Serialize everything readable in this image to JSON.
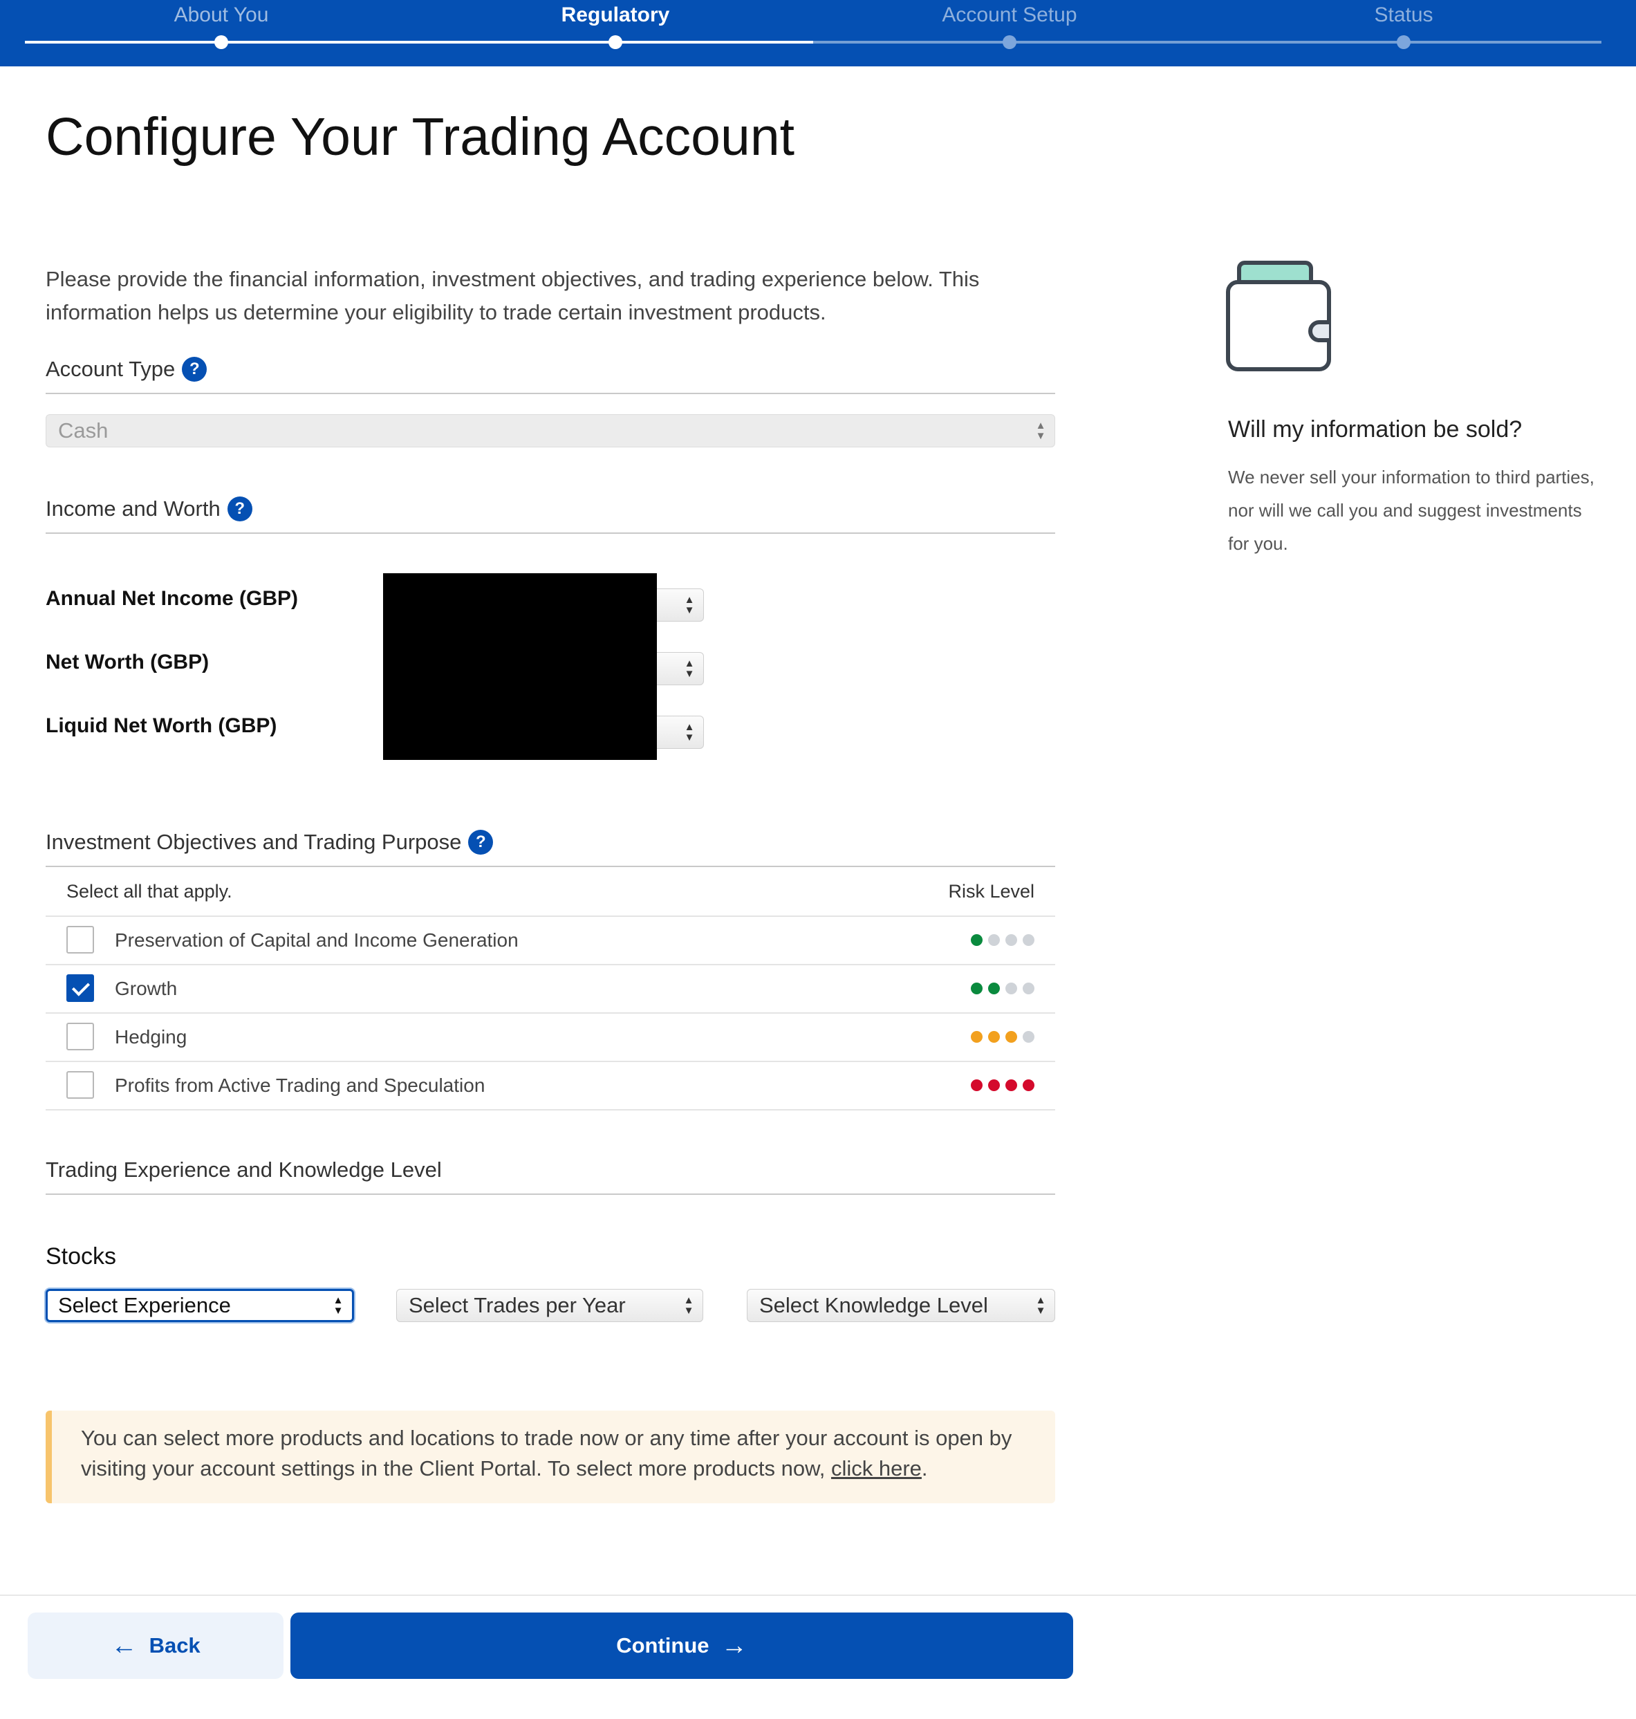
{
  "progress": {
    "steps": [
      {
        "label": "About You",
        "state": "done"
      },
      {
        "label": "Regulatory",
        "state": "current"
      },
      {
        "label": "Account Setup",
        "state": "upcoming"
      },
      {
        "label": "Status",
        "state": "upcoming"
      }
    ]
  },
  "page": {
    "title": "Configure Your Trading Account",
    "intro": "Please provide the financial information, investment objectives, and trading experience below. This information helps us determine your eligibility to trade certain investment products."
  },
  "account_type": {
    "heading": "Account Type",
    "help": "?",
    "selected": "Cash"
  },
  "income": {
    "heading": "Income and Worth",
    "help": "?",
    "fields": [
      {
        "label": "Annual Net Income (GBP)"
      },
      {
        "label": "Net Worth (GBP)"
      },
      {
        "label": "Liquid Net Worth (GBP)"
      }
    ]
  },
  "objectives": {
    "heading": "Investment Objectives and Trading Purpose",
    "help": "?",
    "select_all": "Select all that apply.",
    "risk_header": "Risk Level",
    "items": [
      {
        "label": "Preservation of Capital and Income Generation",
        "checked": false,
        "risk": 1,
        "risk_color": "#0a8a3e"
      },
      {
        "label": "Growth",
        "checked": true,
        "risk": 2,
        "risk_color": "#0a8a3e"
      },
      {
        "label": "Hedging",
        "checked": false,
        "risk": 3,
        "risk_color": "#f2a01e"
      },
      {
        "label": "Profits from Active Trading and Speculation",
        "checked": false,
        "risk": 4,
        "risk_color": "#d40a2c"
      }
    ],
    "inactive_dot_color": "#cfd3d8"
  },
  "experience": {
    "heading": "Trading Experience and Knowledge Level",
    "product": "Stocks",
    "experience_select": "Select Experience",
    "trades_select": "Select Trades per Year",
    "knowledge_select": "Select Knowledge Level"
  },
  "note": {
    "text": "You can select more products and locations to trade now or any time after your account is open by visiting your account settings in the Client Portal. To select more products now, ",
    "link": "click here",
    "end": "."
  },
  "sidebar": {
    "icon": "wallet-icon",
    "title": "Will my information be sold?",
    "body": "We never sell your information to third parties, nor will we call you and suggest investments for you."
  },
  "footer": {
    "back_label": "Back",
    "continue_label": "Continue"
  },
  "colors": {
    "brand": "#0550b3",
    "note_bg": "#fdf5e8",
    "note_accent": "#f7c46c"
  }
}
